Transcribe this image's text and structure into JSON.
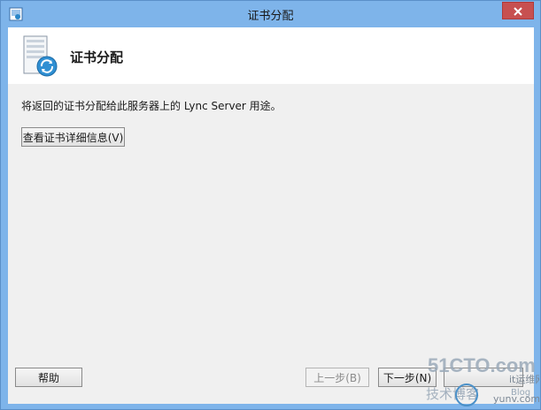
{
  "window": {
    "title": "证书分配"
  },
  "header": {
    "title": "证书分配",
    "icon": "server-refresh-icon"
  },
  "content": {
    "description": "将返回的证书分配给此服务器上的 Lync Server 用途。",
    "view_details_label": "查看证书详细信息(V)"
  },
  "footer": {
    "help_label": "帮助",
    "back_label": "上一步(B)",
    "next_label": "下一步(N)",
    "cancel_label": ""
  },
  "watermark": {
    "brand": "51CTO.com",
    "line2": "技术博客",
    "line3": "Blog",
    "site": "it运维网",
    "url": "yunv.com"
  },
  "colors": {
    "titlebar": "#7eb4ea",
    "close_button": "#c75050",
    "client_background": "#f0f0f0"
  }
}
